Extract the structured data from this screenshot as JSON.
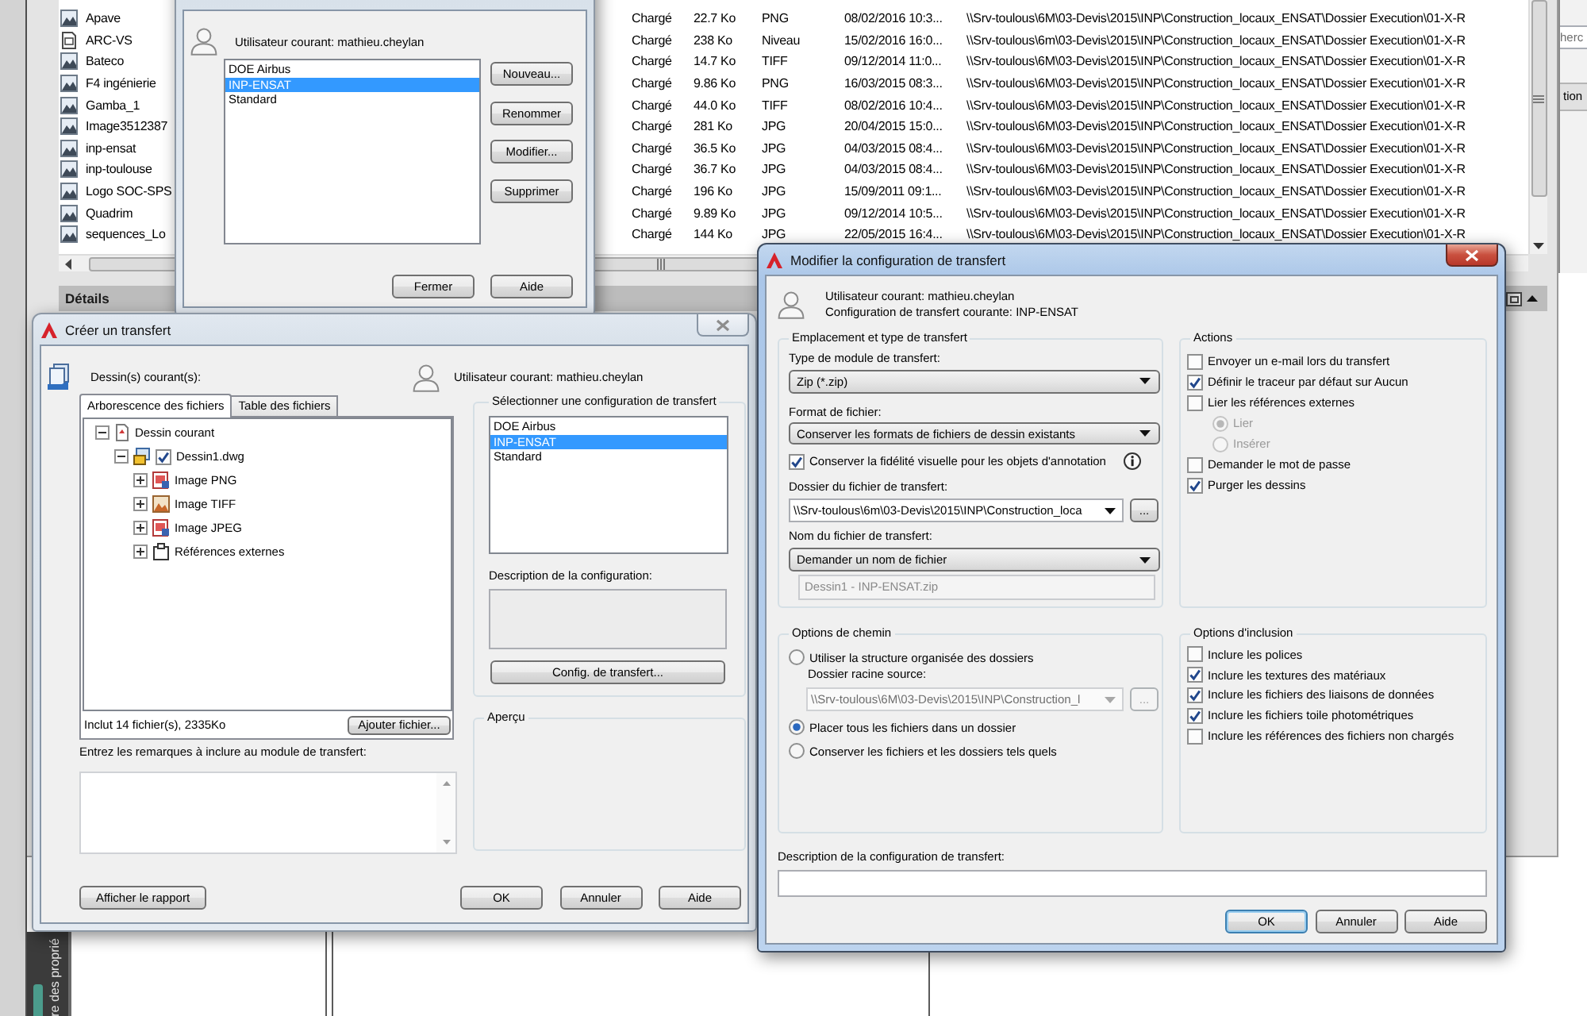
{
  "file_list": {
    "rows": [
      {
        "kind": "image",
        "name": "Apave",
        "status": "Chargé",
        "size": "22.7 Ko",
        "type": "PNG",
        "date": "08/02/2016 10:3...",
        "path": "\\\\Srv-toulous\\6M\\03-Devis\\2015\\INP\\Construction_locaux_ENSAT\\Dossier Execution\\01-X-R"
      },
      {
        "kind": "drawing",
        "name": "ARC-VS",
        "status": "Chargé",
        "size": "238 Ko",
        "type": "Niveau",
        "date": "15/02/2016 16:0...",
        "path": "\\\\Srv-toulous\\6m\\03-Devis\\2015\\INP\\Construction_locaux_ENSAT\\Dossier Execution\\01-X-R"
      },
      {
        "kind": "image",
        "name": "Bateco",
        "status": "Chargé",
        "size": "14.7 Ko",
        "type": "TIFF",
        "date": "09/12/2014 11:0...",
        "path": "\\\\Srv-toulous\\6M\\03-Devis\\2015\\INP\\Construction_locaux_ENSAT\\Dossier Execution\\01-X-R"
      },
      {
        "kind": "image",
        "name": "F4 ingénierie",
        "status": "Chargé",
        "size": "9.86 Ko",
        "type": "PNG",
        "date": "16/03/2015 08:3...",
        "path": "\\\\Srv-toulous\\6M\\03-Devis\\2015\\INP\\Construction_locaux_ENSAT\\Dossier Execution\\01-X-R"
      },
      {
        "kind": "image",
        "name": "Gamba_1",
        "status": "Chargé",
        "size": "44.0 Ko",
        "type": "TIFF",
        "date": "08/02/2016 10:4...",
        "path": "\\\\Srv-toulous\\6M\\03-Devis\\2015\\INP\\Construction_locaux_ENSAT\\Dossier Execution\\01-X-R"
      },
      {
        "kind": "image",
        "name": "Image3512387",
        "status": "Chargé",
        "size": "281 Ko",
        "type": "JPG",
        "date": "20/04/2015 15:0...",
        "path": "\\\\Srv-toulous\\6M\\03-Devis\\2015\\INP\\Construction_locaux_ENSAT\\Dossier Execution\\01-X-R"
      },
      {
        "kind": "image",
        "name": "inp-ensat",
        "status": "Chargé",
        "size": "36.5 Ko",
        "type": "JPG",
        "date": "04/03/2015 08:4...",
        "path": "\\\\Srv-toulous\\6M\\03-Devis\\2015\\INP\\Construction_locaux_ENSAT\\Dossier Execution\\01-X-R"
      },
      {
        "kind": "image",
        "name": "inp-toulouse",
        "status": "Chargé",
        "size": "36.7 Ko",
        "type": "JPG",
        "date": "04/03/2015 08:4...",
        "path": "\\\\Srv-toulous\\6M\\03-Devis\\2015\\INP\\Construction_locaux_ENSAT\\Dossier Execution\\01-X-R"
      },
      {
        "kind": "image",
        "name": "Logo SOC-SPS",
        "status": "Chargé",
        "size": "196 Ko",
        "type": "JPG",
        "date": "15/09/2011 09:1...",
        "path": "\\\\Srv-toulous\\6M\\03-Devis\\2015\\INP\\Construction_locaux_ENSAT\\Dossier Execution\\01-X-R"
      },
      {
        "kind": "image",
        "name": "Quadrim",
        "status": "Chargé",
        "size": "9.89 Ko",
        "type": "JPG",
        "date": "09/12/2014 10:5...",
        "path": "\\\\Srv-toulous\\6M\\03-Devis\\2015\\INP\\Construction_locaux_ENSAT\\Dossier Execution\\01-X-R"
      },
      {
        "kind": "image",
        "name": "sequences_Lo",
        "status": "Chargé",
        "size": "144 Ko",
        "type": "JPG",
        "date": "22/05/2015 16:4...",
        "path": "\\\\Srv-toulous\\6M\\03-Devis\\2015\\INP\\Construction_locaux_ENSAT\\Dossier Execution\\01-X-R"
      }
    ]
  },
  "details_bar": {
    "title": "Détails"
  },
  "side_panel": {
    "field_text": "herc",
    "column_header": "tion"
  },
  "properties_palette": {
    "title": "re des proprié"
  },
  "configurations_dialog": {
    "active": false,
    "user_label": "Utilisateur courant: mathieu.cheylan",
    "configurations": [
      {
        "label": "DOE Airbus",
        "selected": false
      },
      {
        "label": "INP-ENSAT",
        "selected": true
      },
      {
        "label": "Standard",
        "selected": false
      }
    ],
    "side_buttons": [
      "Nouveau...",
      "Renommer",
      "Modifier...",
      "Supprimer"
    ],
    "footer_buttons": [
      "Fermer",
      "Aide"
    ]
  },
  "create_transfer_dialog": {
    "title": "Créer un transfert",
    "active": false,
    "drawings_label": "Dessin(s) courant(s):",
    "user_label": "Utilisateur courant: mathieu.cheylan",
    "tabs": [
      {
        "label": "Arborescence des fichiers",
        "selected": true
      },
      {
        "label": "Table des fichiers",
        "selected": false
      }
    ],
    "tree": [
      {
        "kind": "drawing",
        "label": "Dessin courant",
        "expanded": true,
        "children": [
          {
            "kind": "dwg",
            "label": "Dessin1.dwg",
            "expanded": true,
            "checked": true,
            "children": [
              {
                "kind": "png",
                "label": "Image PNG",
                "expanded": false
              },
              {
                "kind": "tiff",
                "label": "Image TIFF",
                "expanded": false
              },
              {
                "kind": "jpeg",
                "label": "Image JPEG",
                "expanded": false
              },
              {
                "kind": "xref",
                "label": "Références externes",
                "expanded": false
              }
            ]
          }
        ]
      }
    ],
    "summary": "Inclut 14 fichier(s), 2335Ko",
    "add_file_button": "Ajouter fichier...",
    "notes_label": "Entrez les remarques à inclure au module de transfert:",
    "configuration_group": {
      "title": "Sélectionner une configuration de transfert",
      "configurations": [
        {
          "label": "DOE Airbus",
          "selected": false
        },
        {
          "label": "INP-ENSAT",
          "selected": true
        },
        {
          "label": "Standard",
          "selected": false
        }
      ],
      "description_label": "Description de la configuration:",
      "config_button": "Config. de transfert..."
    },
    "preview_group": {
      "title": "Aperçu"
    },
    "report_button": "Afficher le rapport",
    "buttons": [
      "OK",
      "Annuler",
      "Aide"
    ]
  },
  "modify_dialog": {
    "title": "Modifier la configuration de transfert",
    "active": true,
    "user_label": "Utilisateur courant: mathieu.cheylan",
    "config_label": "Configuration de transfert courante: INP-ENSAT",
    "location_group": {
      "title": "Emplacement et type de transfert",
      "module_type": {
        "label": "Type de module de transfert:",
        "value": "Zip (*.zip)"
      },
      "file_format": {
        "label": "Format de fichier:",
        "value": "Conserver les formats de fichiers de dessin existants"
      },
      "visual_fidelity": {
        "label": "Conserver la fidélité visuelle pour les objets d'annotation",
        "checked": true
      },
      "transfer_folder": {
        "label": "Dossier du fichier de transfert:",
        "value": "\\\\Srv-toulous\\6m\\03-Devis\\2015\\INP\\Construction_loca",
        "browse_button": "..."
      },
      "file_name": {
        "label": "Nom du fichier de transfert:",
        "value": "Demander un nom de fichier",
        "preview": "Dessin1 - INP-ENSAT.zip"
      }
    },
    "actions_group": {
      "title": "Actions",
      "items": [
        {
          "kind": "checkbox",
          "label": "Envoyer un e-mail lors du transfert",
          "checked": false,
          "disabled": false
        },
        {
          "kind": "checkbox",
          "label": "Définir le traceur par défaut sur Aucun",
          "checked": true,
          "disabled": false
        },
        {
          "kind": "checkbox",
          "label": "Lier les références externes",
          "checked": false,
          "disabled": false
        },
        {
          "kind": "radio",
          "label": "Lier",
          "selected": true,
          "disabled": true
        },
        {
          "kind": "radio",
          "label": "Insérer",
          "selected": false,
          "disabled": true
        },
        {
          "kind": "checkbox",
          "label": "Demander le mot de passe",
          "checked": false,
          "disabled": false
        },
        {
          "kind": "checkbox",
          "label": "Purger les dessins",
          "checked": true,
          "disabled": false
        }
      ]
    },
    "path_group": {
      "title": "Options de chemin",
      "options": [
        {
          "label": "Utiliser la structure organisée des dossiers",
          "selected": false,
          "field": {
            "label": "Dossier racine source:",
            "value": "\\\\Srv-toulous\\6M\\03-Devis\\2015\\INP\\Construction_l",
            "browse_button": "...",
            "disabled": true
          }
        },
        {
          "label": "Placer tous les fichiers dans un dossier",
          "selected": true
        },
        {
          "label": "Conserver les fichiers et les dossiers tels quels",
          "selected": false
        }
      ]
    },
    "inclusion_group": {
      "title": "Options d'inclusion",
      "items": [
        {
          "label": "Inclure les polices",
          "checked": false
        },
        {
          "label": "Inclure les textures des matériaux",
          "checked": true
        },
        {
          "label": "Inclure les fichiers des liaisons de données",
          "checked": true
        },
        {
          "label": "Inclure les fichiers toile photométriques",
          "checked": true
        },
        {
          "label": "Inclure les références des fichiers non chargés",
          "checked": false
        }
      ]
    },
    "description_label": "Description de la configuration de transfert:",
    "buttons": [
      {
        "label": "OK",
        "default": true
      },
      {
        "label": "Annuler",
        "default": false
      },
      {
        "label": "Aide",
        "default": false
      }
    ]
  }
}
